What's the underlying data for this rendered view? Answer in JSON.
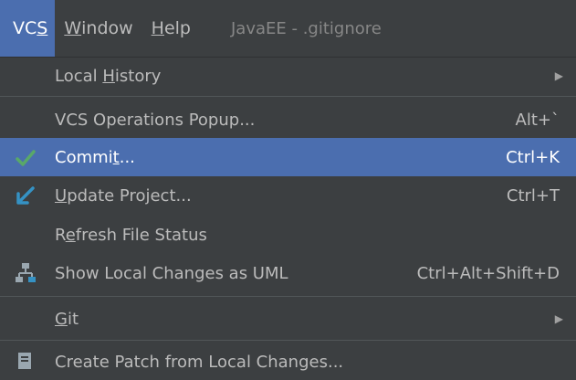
{
  "menubar": {
    "vcs_pre": "VC",
    "vcs_mn": "S",
    "window_mn": "W",
    "window_rest": "indow",
    "help_mn": "H",
    "help_rest": "elp",
    "project_title": "JavaEE - .gitignore"
  },
  "menu": {
    "local_history": {
      "pre": "Local ",
      "mn": "H",
      "post": "istory"
    },
    "vcs_ops": {
      "label": "VCS Operations Popup...",
      "shortcut": "Alt+`"
    },
    "commit": {
      "pre": "Commi",
      "mn": "t",
      "post": "...",
      "shortcut": "Ctrl+K"
    },
    "update": {
      "mn": "U",
      "post": "pdate Project...",
      "shortcut": "Ctrl+T"
    },
    "refresh": {
      "pre": "R",
      "mn": "e",
      "post": "fresh File Status"
    },
    "uml": {
      "label": "Show Local Changes as UML",
      "shortcut": "Ctrl+Alt+Shift+D"
    },
    "git": {
      "mn": "G",
      "post": "it"
    },
    "create_patch": {
      "label": "Create Patch from Local Changes..."
    }
  },
  "colors": {
    "background": "#3c3f41",
    "selection": "#4b6eaf",
    "check_green": "#59a869",
    "update_blue": "#3592c4"
  }
}
